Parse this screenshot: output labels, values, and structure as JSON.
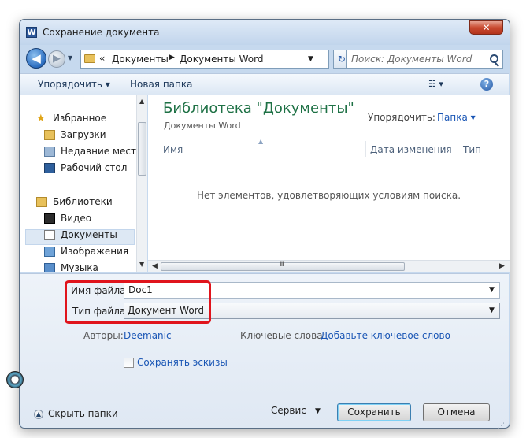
{
  "window": {
    "title": "Сохранение документа",
    "app_icon_letter": "W",
    "close_glyph": "✕"
  },
  "nav": {
    "back_glyph": "◀",
    "forward_glyph": "▶",
    "history_glyph": "▼",
    "address": {
      "overflow": "«",
      "segments": [
        "Документы",
        "Документы Word"
      ],
      "separator": "▶",
      "dropdown": "▼"
    },
    "refresh_glyph": "↻",
    "search_placeholder": "Поиск: Документы Word"
  },
  "toolbar": {
    "organize_label": "Упорядочить ▾",
    "new_folder_label": "Новая папка",
    "view_label": "☷ ▾",
    "help_label": "?"
  },
  "sidebar": {
    "items": [
      {
        "label": "Избранное",
        "icon": "star-icon",
        "type": "head"
      },
      {
        "label": "Загрузки",
        "icon": "downloads-folder-icon",
        "type": "item"
      },
      {
        "label": "Недавние места",
        "icon": "recent-places-icon",
        "type": "item"
      },
      {
        "label": "Рабочий стол",
        "icon": "desktop-icon",
        "type": "item"
      },
      {
        "label": "Библиотеки",
        "icon": "libraries-icon",
        "type": "head"
      },
      {
        "label": "Видео",
        "icon": "video-icon",
        "type": "item"
      },
      {
        "label": "Документы",
        "icon": "documents-icon",
        "type": "item",
        "selected": true
      },
      {
        "label": "Изображения",
        "icon": "pictures-icon",
        "type": "item"
      },
      {
        "label": "Музыка",
        "icon": "music-icon",
        "type": "item"
      }
    ]
  },
  "content": {
    "library_title": "Библиотека \"Документы\"",
    "library_subtitle": "Документы Word",
    "arrange_label": "Упорядочить:",
    "arrange_value": "Папка ▾",
    "columns": [
      "Имя",
      "Дата изменения",
      "Тип"
    ],
    "empty_message": "Нет элементов, удовлетворяющих условиям поиска."
  },
  "form": {
    "filename_label": "Имя файла:",
    "filename_value": "Doc1",
    "filetype_label": "Тип файла:",
    "filetype_value": "Документ Word",
    "authors_label": "Авторы:",
    "authors_value": "Deemanic",
    "tags_label": "Ключевые слова:",
    "tags_value": "Добавьте ключевое слово",
    "save_thumbnails_label": "Сохранять эскизы",
    "hide_folders_label": "Скрыть папки",
    "tools_label": "Сервис",
    "save_label": "Сохранить",
    "cancel_label": "Отмена"
  },
  "colors": {
    "library_title": "#1e7145",
    "link": "#1a56b5",
    "highlight": "#e0141c",
    "close_button": "#c94a30"
  }
}
